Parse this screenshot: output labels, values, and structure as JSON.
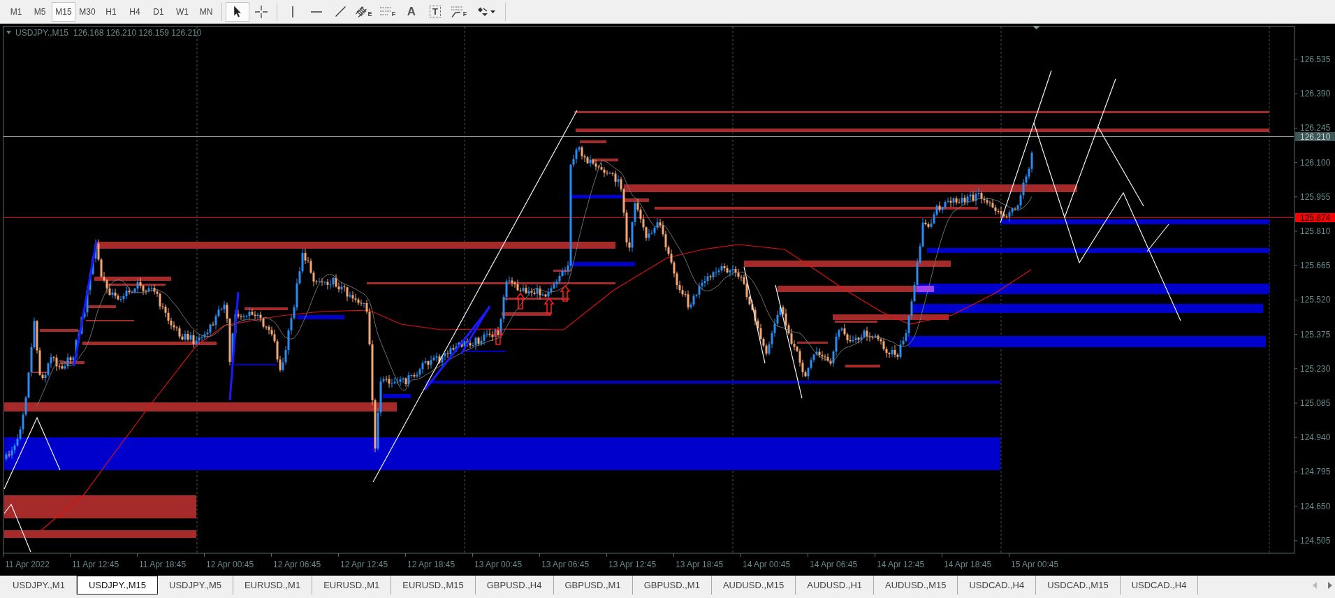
{
  "toolbar": {
    "timeframes": [
      {
        "label": "M1",
        "selected": false
      },
      {
        "label": "M5",
        "selected": false
      },
      {
        "label": "M15",
        "selected": true
      },
      {
        "label": "M30",
        "selected": false
      },
      {
        "label": "H1",
        "selected": false
      },
      {
        "label": "H4",
        "selected": false
      },
      {
        "label": "D1",
        "selected": false
      },
      {
        "label": "W1",
        "selected": false
      },
      {
        "label": "MN",
        "selected": false
      }
    ],
    "tool_groups": [
      {
        "tools": [
          {
            "kind": "cursor",
            "selected": true
          },
          {
            "kind": "crosshair",
            "selected": false
          }
        ]
      },
      {
        "tools": [
          {
            "kind": "vline",
            "selected": false
          },
          {
            "kind": "hline",
            "selected": false
          },
          {
            "kind": "trendline",
            "selected": false
          },
          {
            "kind": "channel",
            "glyph": "E",
            "selected": false
          },
          {
            "kind": "fibo",
            "glyph": "F",
            "selected": false
          },
          {
            "kind": "text",
            "glyph": "A",
            "selected": false
          },
          {
            "kind": "label",
            "glyph": "T",
            "selected": false
          },
          {
            "kind": "fan",
            "glyph": "F",
            "selected": false
          },
          {
            "kind": "shapes",
            "selected": false
          }
        ]
      }
    ]
  },
  "chart": {
    "header": {
      "symbol": "USDJPY.,M15",
      "ohlc": "126.168 126.210 126.159 126.210"
    },
    "price_ticks": [
      "126.535",
      "126.390",
      "126.245",
      "126.100",
      "125.955",
      "125.810",
      "125.665",
      "125.520",
      "125.375",
      "125.230",
      "125.085",
      "124.940",
      "124.795",
      "124.650",
      "124.505"
    ],
    "price_markers": [
      {
        "kind": "bid",
        "value": "126.210"
      },
      {
        "kind": "line",
        "value": "125.874"
      }
    ],
    "time_ticks": [
      "11 Apr 2022",
      "11 Apr 12:45",
      "11 Apr 18:45",
      "12 Apr 00:45",
      "12 Apr 06:45",
      "12 Apr 12:45",
      "12 Apr 18:45",
      "13 Apr 00:45",
      "13 Apr 06:45",
      "13 Apr 12:45",
      "13 Apr 18:45",
      "14 Apr 00:45",
      "14 Apr 06:45",
      "14 Apr 12:45",
      "14 Apr 18:45",
      "15 Apr 00:45"
    ]
  },
  "tabs": [
    {
      "label": "USDJPY.,M1",
      "selected": false
    },
    {
      "label": "USDJPY.,M15",
      "selected": true
    },
    {
      "label": "USDJPY.,M5",
      "selected": false
    },
    {
      "label": "EURUSD.,M1",
      "selected": false
    },
    {
      "label": "EURUSD.,M1",
      "selected": false
    },
    {
      "label": "EURUSD.,M15",
      "selected": false
    },
    {
      "label": "GBPUSD.,H4",
      "selected": false
    },
    {
      "label": "GBPUSD.,M1",
      "selected": false
    },
    {
      "label": "GBPUSD.,M1",
      "selected": false
    },
    {
      "label": "AUDUSD.,M15",
      "selected": false
    },
    {
      "label": "AUDUSD.,H1",
      "selected": false
    },
    {
      "label": "AUDUSD.,M15",
      "selected": false
    },
    {
      "label": "USDCAD.,H4",
      "selected": false
    },
    {
      "label": "USDCAD.,M15",
      "selected": false
    },
    {
      "label": "USDCAD.,H4",
      "selected": false
    }
  ],
  "tab_scroll": [
    {
      "kind": "left",
      "disabled": true
    },
    {
      "kind": "right",
      "disabled": false
    }
  ]
}
